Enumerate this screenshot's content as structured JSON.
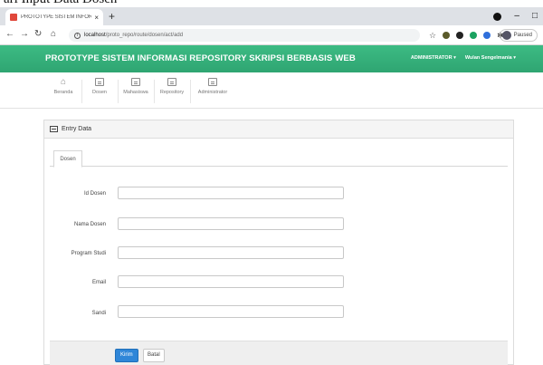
{
  "caption": "ari Input Data Dosen",
  "browser": {
    "tab_title": "PROTOTYPE SISTEM INFORMASI",
    "tab_close": "×",
    "new_tab": "+",
    "url_host": "localhost",
    "url_path": "/proto_repo/route/dosen/act/add",
    "profile_status": "Paused",
    "win_minimize": "–",
    "win_maximize": "□"
  },
  "app": {
    "title": "PROTOTYPE SISTEM INFORMASI REPOSITORY SKRIPSI BERBASIS WEB",
    "admin_menu": "ADMINISTRATOR ▾",
    "user_menu": "Wulan Sengelmania ▾",
    "accent_color": "#36b37e"
  },
  "nav": {
    "items": [
      {
        "label": "Beranda",
        "icon": "home-icon"
      },
      {
        "label": "Dosen",
        "icon": "list-icon"
      },
      {
        "label": "Mahasiswa",
        "icon": "list-icon"
      },
      {
        "label": "Repository",
        "icon": "list-icon"
      },
      {
        "label": "Administrator",
        "icon": "list-icon"
      }
    ]
  },
  "panel": {
    "title": "Entry Data",
    "tab": "Dosen"
  },
  "form": {
    "fields": [
      {
        "label": "Id Dosen",
        "value": ""
      },
      {
        "label": "Nama Dosen",
        "value": ""
      },
      {
        "label": "Program Studi",
        "value": ""
      },
      {
        "label": "Email",
        "value": ""
      },
      {
        "label": "Sandi",
        "value": ""
      }
    ],
    "submit_label": "Kirim",
    "cancel_label": "Batal"
  }
}
